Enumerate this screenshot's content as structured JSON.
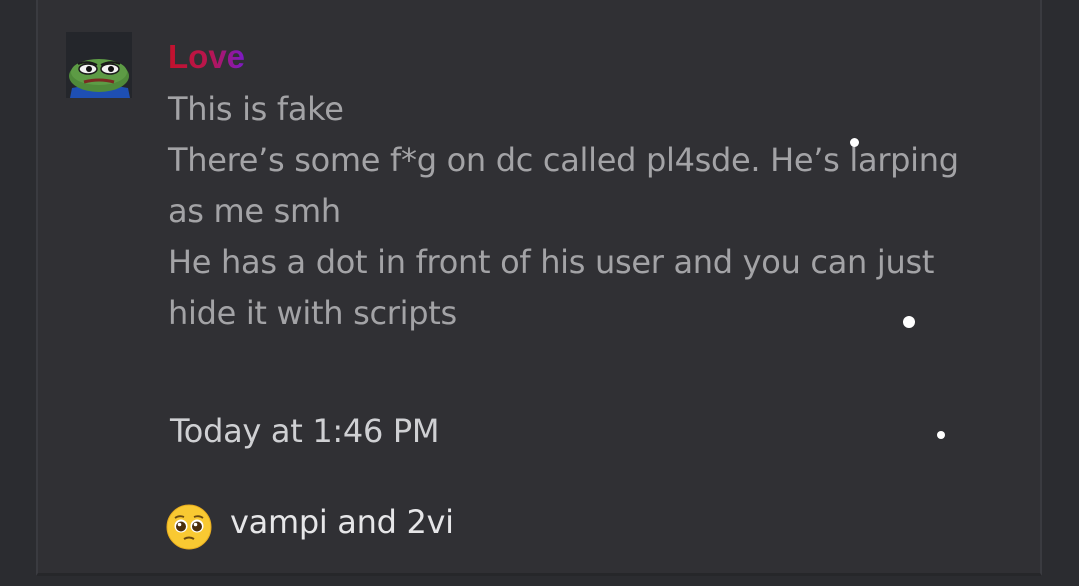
{
  "message": {
    "author": "Love",
    "lines": [
      "This is fake",
      "There’s some f*g on dc called pl4sde. He’s larping",
      "as me smh",
      "He has a dot in front of his user and you can just",
      "hide it with scripts"
    ],
    "timestamp": "Today at 1:46 PM"
  },
  "reaction": {
    "emoji": "pleading-face-icon",
    "users": "vampi and 2vi"
  },
  "avatar": {
    "icon": "pepe-frog-icon"
  },
  "colors": {
    "background": "#2b2c30",
    "card": "#303034",
    "author_gradient": [
      "#c2122c",
      "#7a1ac9"
    ],
    "message_text": "#a3a3a6"
  }
}
